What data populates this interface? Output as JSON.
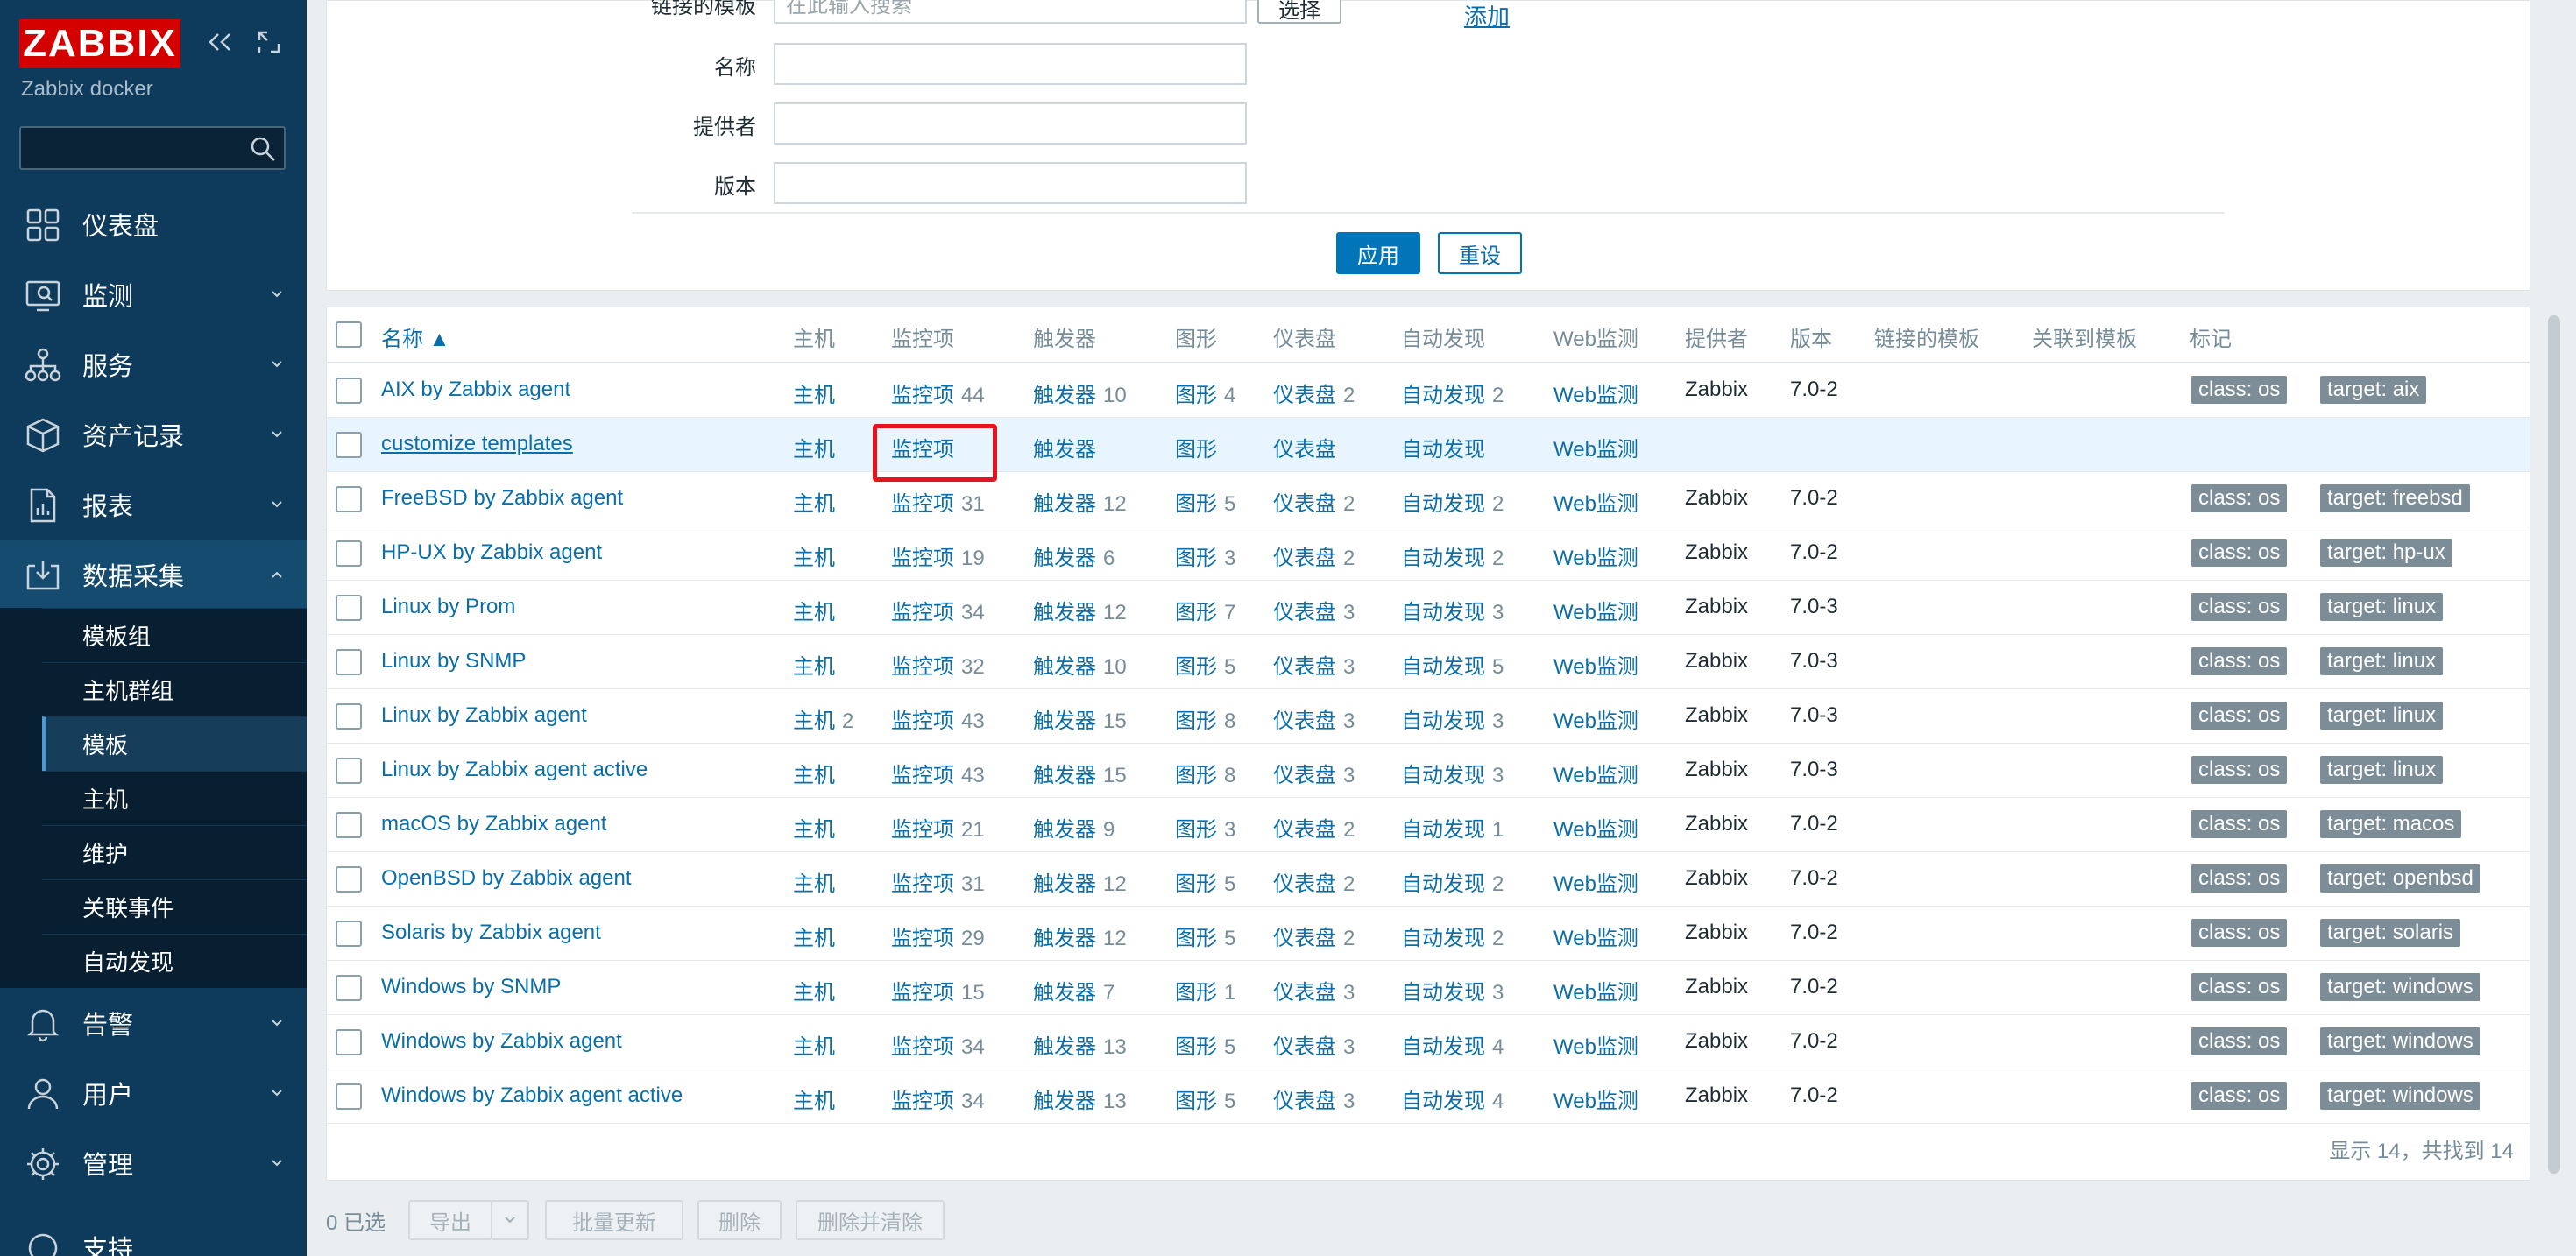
{
  "sidebar": {
    "logo": "ZABBIX",
    "subtitle": "Zabbix docker",
    "search_placeholder": "",
    "menu": [
      {
        "label": "仪表盘",
        "icon": "dashboard-icon"
      },
      {
        "label": "监测",
        "icon": "monitoring-icon"
      },
      {
        "label": "服务",
        "icon": "services-icon"
      },
      {
        "label": "资产记录",
        "icon": "inventory-icon"
      },
      {
        "label": "报表",
        "icon": "reports-icon"
      },
      {
        "label": "数据采集",
        "icon": "data-collection-icon"
      },
      {
        "label": "告警",
        "icon": "alerts-icon"
      },
      {
        "label": "用户",
        "icon": "users-icon"
      },
      {
        "label": "管理",
        "icon": "administration-icon"
      },
      {
        "label": "支持",
        "icon": "support-icon"
      }
    ],
    "submenu": [
      "模板组",
      "主机群组",
      "模板",
      "主机",
      "维护",
      "关联事件",
      "自动发现"
    ]
  },
  "filter": {
    "linked_templates_label": "链接的模板",
    "linked_templates_placeholder": "在此输入搜索",
    "select_button": "选择",
    "add_link": "添加",
    "name_label": "名称",
    "vendor_label": "提供者",
    "version_label": "版本",
    "name_value": "",
    "vendor_value": "",
    "version_value": "",
    "apply_button": "应用",
    "reset_button": "重设"
  },
  "table": {
    "columns": [
      "名称 ▲",
      "主机",
      "监控项",
      "触发器",
      "图形",
      "仪表盘",
      "自动发现",
      "Web监测",
      "提供者",
      "版本",
      "链接的模板",
      "关联到模板",
      "标记"
    ],
    "rows": [
      {
        "name": "AIX by Zabbix agent",
        "hosts": "主机",
        "hosts_n": "",
        "items": "监控项",
        "items_n": "44",
        "triggers": "触发器",
        "triggers_n": "10",
        "graphs": "图形",
        "graphs_n": "4",
        "dash": "仪表盘",
        "dash_n": "2",
        "disc": "自动发现",
        "disc_n": "2",
        "web": "Web监测",
        "vendor": "Zabbix",
        "version": "7.0-2",
        "tags": [
          "class: os",
          "target: aix"
        ]
      },
      {
        "name": "customize templates",
        "hosts": "主机",
        "hosts_n": "",
        "items": "监控项",
        "items_n": "",
        "triggers": "触发器",
        "triggers_n": "",
        "graphs": "图形",
        "graphs_n": "",
        "dash": "仪表盘",
        "dash_n": "",
        "disc": "自动发现",
        "disc_n": "",
        "web": "Web监测",
        "vendor": "",
        "version": "",
        "tags": []
      },
      {
        "name": "FreeBSD by Zabbix agent",
        "hosts": "主机",
        "hosts_n": "",
        "items": "监控项",
        "items_n": "31",
        "triggers": "触发器",
        "triggers_n": "12",
        "graphs": "图形",
        "graphs_n": "5",
        "dash": "仪表盘",
        "dash_n": "2",
        "disc": "自动发现",
        "disc_n": "2",
        "web": "Web监测",
        "vendor": "Zabbix",
        "version": "7.0-2",
        "tags": [
          "class: os",
          "target: freebsd"
        ]
      },
      {
        "name": "HP-UX by Zabbix agent",
        "hosts": "主机",
        "hosts_n": "",
        "items": "监控项",
        "items_n": "19",
        "triggers": "触发器",
        "triggers_n": "6",
        "graphs": "图形",
        "graphs_n": "3",
        "dash": "仪表盘",
        "dash_n": "2",
        "disc": "自动发现",
        "disc_n": "2",
        "web": "Web监测",
        "vendor": "Zabbix",
        "version": "7.0-2",
        "tags": [
          "class: os",
          "target: hp-ux"
        ]
      },
      {
        "name": "Linux by Prom",
        "hosts": "主机",
        "hosts_n": "",
        "items": "监控项",
        "items_n": "34",
        "triggers": "触发器",
        "triggers_n": "12",
        "graphs": "图形",
        "graphs_n": "7",
        "dash": "仪表盘",
        "dash_n": "3",
        "disc": "自动发现",
        "disc_n": "3",
        "web": "Web监测",
        "vendor": "Zabbix",
        "version": "7.0-3",
        "tags": [
          "class: os",
          "target: linux"
        ]
      },
      {
        "name": "Linux by SNMP",
        "hosts": "主机",
        "hosts_n": "",
        "items": "监控项",
        "items_n": "32",
        "triggers": "触发器",
        "triggers_n": "10",
        "graphs": "图形",
        "graphs_n": "5",
        "dash": "仪表盘",
        "dash_n": "3",
        "disc": "自动发现",
        "disc_n": "5",
        "web": "Web监测",
        "vendor": "Zabbix",
        "version": "7.0-3",
        "tags": [
          "class: os",
          "target: linux"
        ]
      },
      {
        "name": "Linux by Zabbix agent",
        "hosts": "主机",
        "hosts_n": "2",
        "items": "监控项",
        "items_n": "43",
        "triggers": "触发器",
        "triggers_n": "15",
        "graphs": "图形",
        "graphs_n": "8",
        "dash": "仪表盘",
        "dash_n": "3",
        "disc": "自动发现",
        "disc_n": "3",
        "web": "Web监测",
        "vendor": "Zabbix",
        "version": "7.0-3",
        "tags": [
          "class: os",
          "target: linux"
        ]
      },
      {
        "name": "Linux by Zabbix agent active",
        "hosts": "主机",
        "hosts_n": "",
        "items": "监控项",
        "items_n": "43",
        "triggers": "触发器",
        "triggers_n": "15",
        "graphs": "图形",
        "graphs_n": "8",
        "dash": "仪表盘",
        "dash_n": "3",
        "disc": "自动发现",
        "disc_n": "3",
        "web": "Web监测",
        "vendor": "Zabbix",
        "version": "7.0-3",
        "tags": [
          "class: os",
          "target: linux"
        ]
      },
      {
        "name": "macOS by Zabbix agent",
        "hosts": "主机",
        "hosts_n": "",
        "items": "监控项",
        "items_n": "21",
        "triggers": "触发器",
        "triggers_n": "9",
        "graphs": "图形",
        "graphs_n": "3",
        "dash": "仪表盘",
        "dash_n": "2",
        "disc": "自动发现",
        "disc_n": "1",
        "web": "Web监测",
        "vendor": "Zabbix",
        "version": "7.0-2",
        "tags": [
          "class: os",
          "target: macos"
        ]
      },
      {
        "name": "OpenBSD by Zabbix agent",
        "hosts": "主机",
        "hosts_n": "",
        "items": "监控项",
        "items_n": "31",
        "triggers": "触发器",
        "triggers_n": "12",
        "graphs": "图形",
        "graphs_n": "5",
        "dash": "仪表盘",
        "dash_n": "2",
        "disc": "自动发现",
        "disc_n": "2",
        "web": "Web监测",
        "vendor": "Zabbix",
        "version": "7.0-2",
        "tags": [
          "class: os",
          "target: openbsd"
        ]
      },
      {
        "name": "Solaris by Zabbix agent",
        "hosts": "主机",
        "hosts_n": "",
        "items": "监控项",
        "items_n": "29",
        "triggers": "触发器",
        "triggers_n": "12",
        "graphs": "图形",
        "graphs_n": "5",
        "dash": "仪表盘",
        "dash_n": "2",
        "disc": "自动发现",
        "disc_n": "2",
        "web": "Web监测",
        "vendor": "Zabbix",
        "version": "7.0-2",
        "tags": [
          "class: os",
          "target: solaris"
        ]
      },
      {
        "name": "Windows by SNMP",
        "hosts": "主机",
        "hosts_n": "",
        "items": "监控项",
        "items_n": "15",
        "triggers": "触发器",
        "triggers_n": "7",
        "graphs": "图形",
        "graphs_n": "1",
        "dash": "仪表盘",
        "dash_n": "3",
        "disc": "自动发现",
        "disc_n": "3",
        "web": "Web监测",
        "vendor": "Zabbix",
        "version": "7.0-2",
        "tags": [
          "class: os",
          "target: windows"
        ]
      },
      {
        "name": "Windows by Zabbix agent",
        "hosts": "主机",
        "hosts_n": "",
        "items": "监控项",
        "items_n": "34",
        "triggers": "触发器",
        "triggers_n": "13",
        "graphs": "图形",
        "graphs_n": "5",
        "dash": "仪表盘",
        "dash_n": "3",
        "disc": "自动发现",
        "disc_n": "4",
        "web": "Web监测",
        "vendor": "Zabbix",
        "version": "7.0-2",
        "tags": [
          "class: os",
          "target: windows"
        ]
      },
      {
        "name": "Windows by Zabbix agent active",
        "hosts": "主机",
        "hosts_n": "",
        "items": "监控项",
        "items_n": "34",
        "triggers": "触发器",
        "triggers_n": "13",
        "graphs": "图形",
        "graphs_n": "5",
        "dash": "仪表盘",
        "dash_n": "3",
        "disc": "自动发现",
        "disc_n": "4",
        "web": "Web监测",
        "vendor": "Zabbix",
        "version": "7.0-2",
        "tags": [
          "class: os",
          "target: windows"
        ]
      }
    ],
    "footer": "显示 14，共找到 14"
  },
  "bottom": {
    "selected": "0 已选",
    "export": "导出",
    "mass_update": "批量更新",
    "delete": "删除",
    "delete_clear": "删除并清除"
  },
  "colors": {
    "sidebar_bg": "#0e3b5c",
    "logo_bg": "#d40000",
    "link": "#0b6ea8",
    "primary_button": "#0275b8",
    "highlight_box": "#e8141d",
    "tag_bg": "#7c8d98",
    "row_highlight": "#e8f5ff"
  }
}
